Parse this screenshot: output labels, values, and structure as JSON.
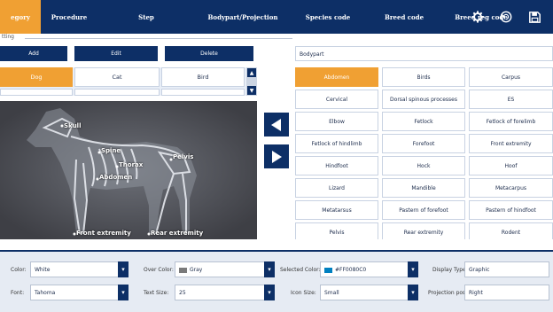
{
  "tabs": {
    "items": [
      {
        "label": "egory",
        "active": true
      },
      {
        "label": "Procedure",
        "active": false
      },
      {
        "label": "Step",
        "active": false
      },
      {
        "label": "Bodypart/Projection",
        "active": false
      },
      {
        "label": "Species code",
        "active": false
      },
      {
        "label": "Breed code",
        "active": false
      },
      {
        "label": "Breed reg code",
        "active": false
      }
    ],
    "icons": [
      "gear-icon",
      "refresh-icon",
      "save-icon"
    ]
  },
  "section_legend": "tting",
  "toolbar": {
    "add_label": "Add",
    "edit_label": "Edit",
    "delete_label": "Delete"
  },
  "species": [
    {
      "label": "Dog",
      "active": true
    },
    {
      "label": "Cat",
      "active": false
    },
    {
      "label": "Bird",
      "active": false
    }
  ],
  "xray_labels": {
    "skull": "Skull",
    "spine": "Spine",
    "pelvis": "Pelvis",
    "thorax": "Thorax",
    "abdomen": "Abdomen",
    "front_extremity": "Front extremity",
    "rear_extremity": "Rear extremity"
  },
  "bodypart_field": "Bodypart",
  "bodyparts": [
    {
      "label": "Abdomen",
      "active": true
    },
    {
      "label": "Birds"
    },
    {
      "label": "Carpus"
    },
    {
      "label": "Cervical"
    },
    {
      "label": "Dorsal spinous processes"
    },
    {
      "label": "ES"
    },
    {
      "label": "Elbow"
    },
    {
      "label": "Fetlock"
    },
    {
      "label": "Fetlock of forelimb"
    },
    {
      "label": "Fetlock of hindlimb"
    },
    {
      "label": "Forefoot"
    },
    {
      "label": "Front extremity"
    },
    {
      "label": "Hindfoot"
    },
    {
      "label": "Hock"
    },
    {
      "label": "Hoof"
    },
    {
      "label": "Lizard"
    },
    {
      "label": "Mandible"
    },
    {
      "label": "Metacarpus"
    },
    {
      "label": "Metatarsus"
    },
    {
      "label": "Pastern of forefoot"
    },
    {
      "label": "Pastern of hindfoot"
    },
    {
      "label": "Pelvis"
    },
    {
      "label": "Rear extremity"
    },
    {
      "label": "Rodent"
    }
  ],
  "settings": {
    "color_label": "Color:",
    "color_value": "White",
    "over_color_label": "Over Color:",
    "over_color_value": "Gray",
    "selected_color_label": "Selected Color:",
    "selected_color_value": "#FF0080C0",
    "display_type_label": "Display Type:",
    "display_type_value": "Graphic",
    "font_label": "Font:",
    "font_value": "Tahoma",
    "text_size_label": "Text Size:",
    "text_size_value": "25",
    "icon_size_label": "Icon Size:",
    "icon_size_value": "Small",
    "projection_pos_label": "Projection pos:",
    "projection_pos_value": "Right"
  },
  "colors": {
    "nav": "#0d2f66",
    "accent": "#f0a033",
    "over_gray": "#7a7a7a",
    "selected_blue": "#0080c0"
  }
}
